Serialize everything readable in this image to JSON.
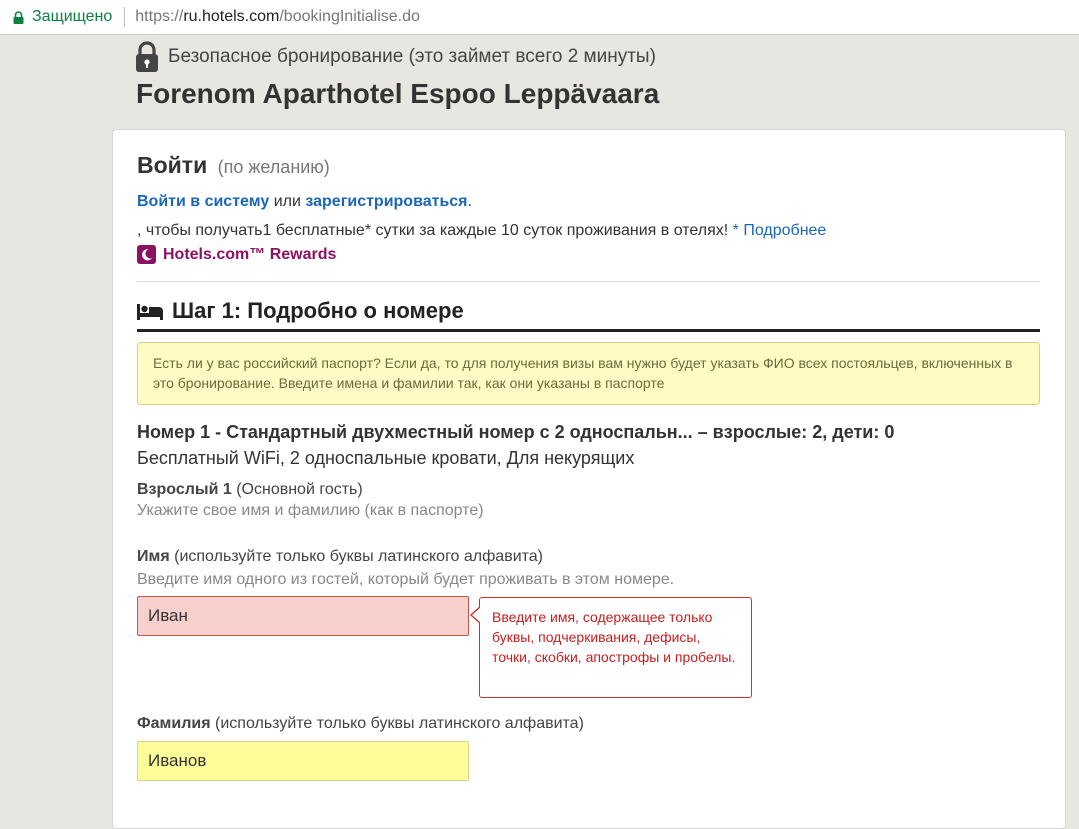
{
  "address_bar": {
    "secure_label": "Защищено",
    "url_scheme": "https://",
    "url_host": "ru.hotels.com",
    "url_path": "/bookingInitialise.do"
  },
  "header": {
    "secure_text": "Безопасное бронирование (это займет всего 2 минуты)",
    "hotel_name": "Forenom Aparthotel Espoo Leppävaara"
  },
  "login": {
    "title": "Войти",
    "optional": "(по желанию)",
    "signin_link": "Войти в систему",
    "or_text": "или",
    "register_link": "зарегистрироваться",
    "period": ".",
    "promo_text": ", чтобы получать1 бесплатные* сутки за каждые 10 суток проживания в отелях!",
    "more_link": "* Подробнее",
    "rewards_label": "Hotels.com™ Rewards"
  },
  "step1": {
    "title": "Шаг 1: Подробно о номере",
    "notice": "Есть ли у вас российский паспорт? Если да, то для получения визы вам нужно будет указать ФИО всех постояльцев, включенных в это бронирование. Введите имена и фамилии так, как они указаны в паспорте"
  },
  "room": {
    "heading": "Номер 1 - Стандартный двухместный номер с 2 односпальн... – взрослые: 2, дети: 0",
    "features": "Бесплатный WiFi, 2 односпальные кровати, Для некурящих"
  },
  "guest": {
    "label_bold": "Взрослый 1",
    "label_rest": "(Основной гость)",
    "hint": "Укажите свое имя и фамилию (как в паспорте)"
  },
  "first_name": {
    "label_bold": "Имя",
    "label_rest": "(используйте только буквы латинского алфавита)",
    "hint": "Введите имя одного из гостей, который будет проживать в этом номере.",
    "value": "Иван",
    "error": "Введите имя, содержащее только буквы, подчеркивания, дефисы, точки, скобки, апострофы и пробелы."
  },
  "last_name": {
    "label_bold": "Фамилия",
    "label_rest": "(используйте только буквы латинского алфавита)",
    "value": "Иванов"
  },
  "colors": {
    "link": "#1967b6",
    "rewards": "#8d1163",
    "error": "#c81e1e",
    "notice_bg": "#fffbc4"
  },
  "icons": [
    "lock-icon",
    "padlock-icon",
    "rewards-moon-icon",
    "bed-icon"
  ]
}
